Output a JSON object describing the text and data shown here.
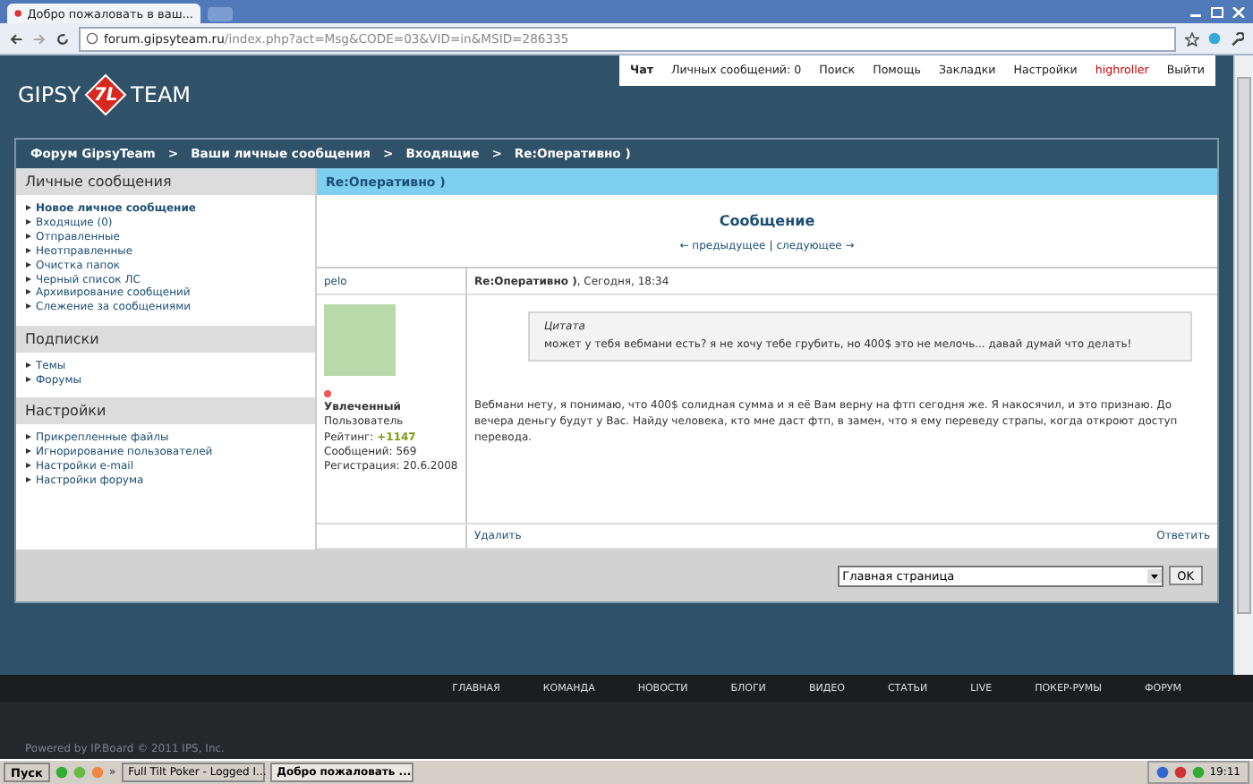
{
  "browser": {
    "tab_title": "Добро пожаловать в ваш...",
    "url_host": "forum.gipsyteam.ru",
    "url_path": "/index.php?act=Msg&CODE=03&VID=in&MSID=286335"
  },
  "top_nav": [
    {
      "label": "Чат",
      "selected": true
    },
    {
      "label": "Личных сообщений: 0",
      "selected": false
    },
    {
      "label": "Поиск",
      "selected": false
    },
    {
      "label": "Помощь",
      "selected": false
    },
    {
      "label": "Закладки",
      "selected": false
    },
    {
      "label": "Настройки",
      "selected": false
    },
    {
      "label": "highroller",
      "selected": false,
      "color": "#cc0000"
    },
    {
      "label": "Выйти",
      "selected": false
    }
  ],
  "logo": {
    "left": "GIPSY",
    "mark": "7L",
    "right": "TEAM"
  },
  "breadcrumb": [
    "Форум GipsyTeam",
    "Ваши личные сообщения",
    "Входящие",
    "Re:Оперативно )"
  ],
  "breadcrumb_separator": ">",
  "sidebar": [
    {
      "title": "Личные сообщения",
      "items": [
        {
          "label": "Новое личное сообщение",
          "selected": true
        },
        {
          "label": "Входящие (0)",
          "selected": false
        },
        {
          "label": "Отправленные",
          "selected": false
        },
        {
          "label": "Неотправленные",
          "selected": false
        },
        {
          "label": "Очистка папок",
          "selected": false
        },
        {
          "label": "Черный список ЛС",
          "selected": false
        },
        {
          "label": "Архивирование сообщений",
          "selected": false
        },
        {
          "label": "Слежение за сообщениями",
          "selected": false
        }
      ]
    },
    {
      "title": "Подписки",
      "items": [
        {
          "label": "Темы",
          "selected": false
        },
        {
          "label": "Форумы",
          "selected": false
        }
      ]
    },
    {
      "title": "Настройки",
      "items": [
        {
          "label": "Прикрепленные файлы",
          "selected": false
        },
        {
          "label": "Игнорирование пользователей",
          "selected": false
        },
        {
          "label": "Настройки e-mail",
          "selected": false
        },
        {
          "label": "Настройки форума",
          "selected": false
        }
      ]
    }
  ],
  "message": {
    "header": "Re:Оперативно )",
    "heading": "Сообщение",
    "prev": "← предыдущее",
    "separator": "|",
    "next": "следующее →",
    "author": {
      "name": "pelo",
      "online": false,
      "group": "Увлеченный",
      "role": "Пользователь",
      "rating_label": "Рейтинг:",
      "rating": "+1147",
      "posts": "Сообщений: 569",
      "registered": "Регистрация: 20.6.2008"
    },
    "title": "Re:Оперативно )",
    "date": ", Сегодня, 18:34",
    "quote_label": "Цитата",
    "quote": "может у тебя вебмани есть? я не хочу тебе грубить, но 400$ это не мелочь... давай думай что делать!",
    "body": "Вебмани нету, я понимаю, что 400$ солидная сумма и я её Вам верну на фтп сегодня же. Я накосячил, и это признаю. До вечера деньгу будут у Вас. Найду человека, кто мне даст фтп, в замен, что я ему переведу страпы, когда откроют доступ перевода.",
    "delete": "Удалить",
    "reply": "Ответить"
  },
  "jump": {
    "value": "Главная страница",
    "button": "OK"
  },
  "footer_menu": [
    "ГЛАВНАЯ",
    "КОМАНДА",
    "НОВОСТИ",
    "БЛОГИ",
    "ВИДЕО",
    "СТАТЬИ",
    "LIVE",
    "ПОКЕР-РУМЫ",
    "ФОРУМ"
  ],
  "copyright": "Powered by IP.Board © 2011  IPS, Inc.",
  "taskbar": {
    "start": "Пуск",
    "more": "»",
    "windows": [
      {
        "label": "Full Tilt Poker - Logged I...",
        "selected": false
      },
      {
        "label": "Добро пожаловать ...",
        "selected": true
      }
    ],
    "clock": "19:11"
  }
}
